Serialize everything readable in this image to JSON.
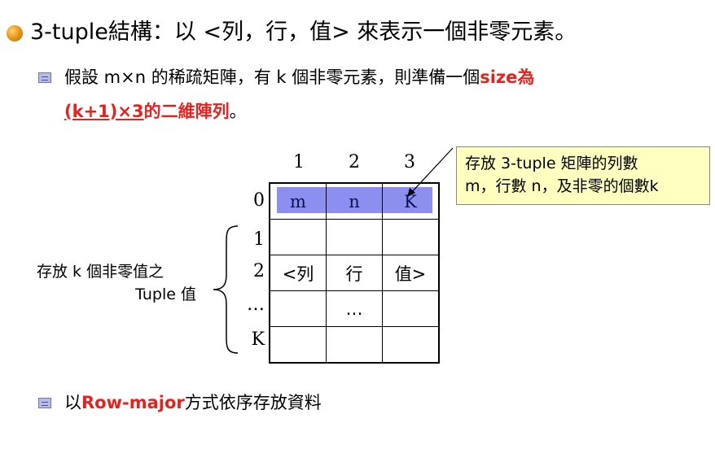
{
  "title": "3-tuple結構：以 <列，行，值> 來表示一個非零元素。",
  "bullet1": {
    "text": "假設 m×n 的稀疏矩陣，有 k 個非零元素，則準備一個",
    "highlight": "size為",
    "line2_underlined": "(k+1)×3",
    "line2_red": "的二維陣列",
    "line2_end": "。"
  },
  "column_headers": [
    "1",
    "2",
    "3"
  ],
  "row_labels": [
    "0",
    "1",
    "2",
    "…",
    "K"
  ],
  "table_rows": [
    [
      "m",
      "n",
      "K"
    ],
    [
      "",
      "",
      ""
    ],
    [
      "<列",
      "行",
      "值>"
    ],
    [
      "",
      "…",
      ""
    ],
    [
      "",
      "",
      ""
    ]
  ],
  "note": {
    "line1": "存放 3-tuple 矩陣的列數",
    "line2": "m，行數 n，及非零的個數k"
  },
  "left_label": {
    "line1": "存放 k 個非零值之",
    "line2": "Tuple 值"
  },
  "bullet2": {
    "prefix": "以",
    "red": "Row-major",
    "suffix": "方式依序存放資料"
  },
  "colors": {
    "accent_red": "#e5231e",
    "header_row_fill": "#8c8ff0",
    "note_fill": "#ffffc0"
  }
}
